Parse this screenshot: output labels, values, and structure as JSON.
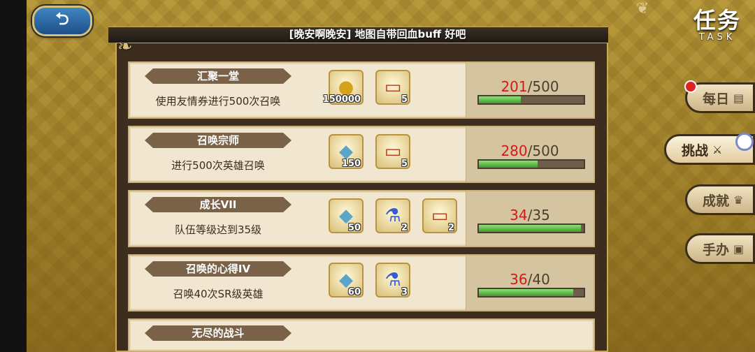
{
  "header": {
    "back_icon": "back-arrow-icon",
    "title": "任务",
    "subtitle": "TASK",
    "broadcast": "[晚安啊晚安] 地图自带回血buff 好吧"
  },
  "side_tabs": [
    {
      "label": "每日",
      "icon": "calendar-icon",
      "glyph": "▤",
      "badge": true
    },
    {
      "label": "挑战",
      "icon": "crossed-swords-icon",
      "glyph": "⚔",
      "active": true
    },
    {
      "label": "成就",
      "icon": "trophy-icon",
      "glyph": "♛"
    },
    {
      "label": "手办",
      "icon": "figure-icon",
      "glyph": "▣"
    }
  ],
  "tasks": [
    {
      "title": "汇聚一堂",
      "desc": "使用友情券进行500次召唤",
      "rewards": [
        {
          "icon": "coin-icon",
          "glyph": "●",
          "qty": "150000"
        },
        {
          "icon": "card-icon",
          "glyph": "▭",
          "qty": "5"
        }
      ],
      "current": "201",
      "total": "/500",
      "progress": 0.402
    },
    {
      "title": "召唤宗师",
      "desc": "进行500次英雄召唤",
      "rewards": [
        {
          "icon": "rainbow-gem-icon",
          "glyph": "◆",
          "qty": "150"
        },
        {
          "icon": "card-icon",
          "glyph": "▭",
          "qty": "5"
        }
      ],
      "current": "280",
      "total": "/500",
      "progress": 0.56
    },
    {
      "title": "成长VII",
      "desc": "队伍等级达到35级",
      "rewards": [
        {
          "icon": "rainbow-gem-icon",
          "glyph": "◆",
          "qty": "50"
        },
        {
          "icon": "potion-icon",
          "glyph": "⚗",
          "qty": "2"
        },
        {
          "icon": "card-icon",
          "glyph": "▭",
          "qty": "2"
        }
      ],
      "current": "34",
      "total": "/35",
      "progress": 0.971
    },
    {
      "title": "召唤的心得IV",
      "desc": "召唤40次SR级英雄",
      "rewards": [
        {
          "icon": "rainbow-gem-icon",
          "glyph": "◆",
          "qty": "60"
        },
        {
          "icon": "potion-icon",
          "glyph": "⚗",
          "qty": "3"
        }
      ],
      "current": "36",
      "total": "/40",
      "progress": 0.9
    },
    {
      "title": "无尽的战斗"
    }
  ],
  "colors": {
    "accent_red": "#d21a1a",
    "bar_green": "#3e9b2b"
  }
}
